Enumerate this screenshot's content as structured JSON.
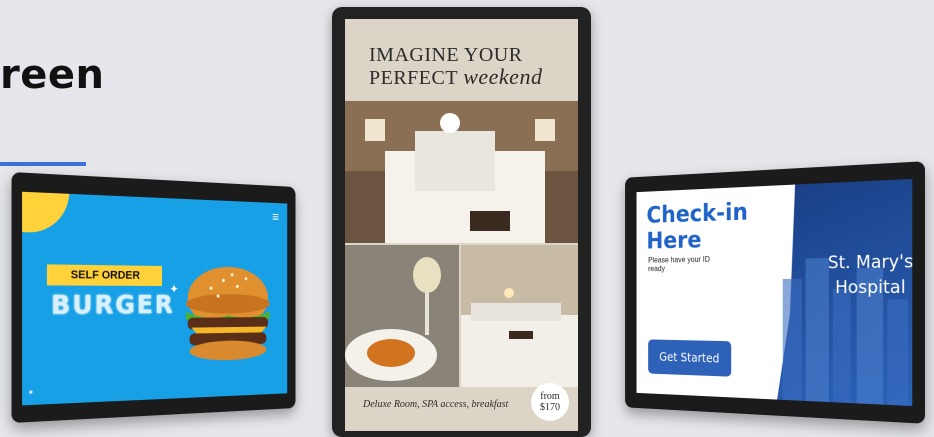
{
  "page": {
    "headline": "reen"
  },
  "kiosk_left": {
    "badge": "SELF ORDER",
    "title": "BURGER",
    "menu_icon": "hamburger-menu-icon",
    "accent": "#17a0e5",
    "badge_color": "#ffd23a"
  },
  "kiosk_center": {
    "title_line1": "IMAGINE YOUR",
    "title_line2_plain": "PERFECT",
    "title_line2_script": "weekend",
    "caption": "Deluxe Room, SPA access, breakfast",
    "price_from": "from",
    "price_value": "$170"
  },
  "kiosk_right": {
    "title_line1": "Check-in",
    "title_line2": "Here",
    "subtitle": "Please have your ID ready",
    "button_label": "Get Started",
    "hospital_line1": "St. Mary's",
    "hospital_line2": "Hospital",
    "brand_blue": "#1f62c8"
  }
}
